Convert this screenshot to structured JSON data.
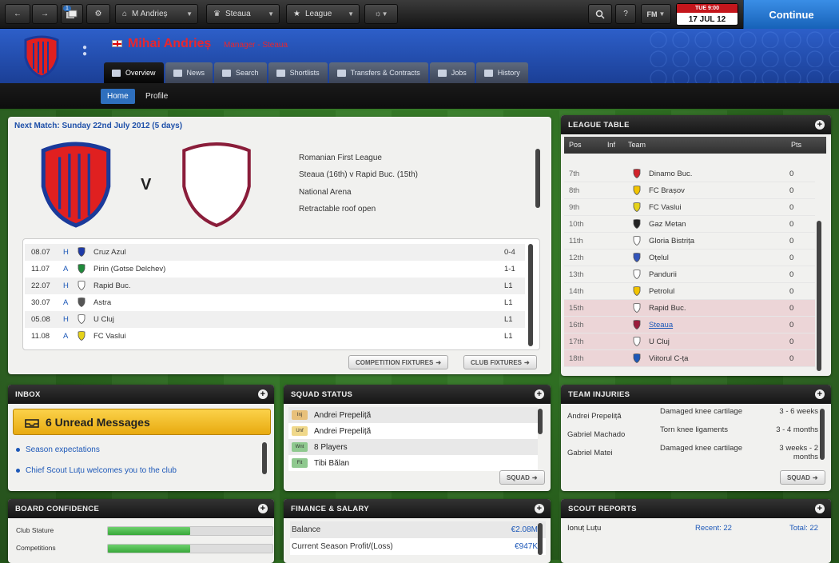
{
  "topbar": {
    "manager_dropdown": "M Andrieș",
    "club_dropdown": "Steaua",
    "league_dropdown": "League",
    "fm_menu": "FM",
    "badge_count": "1",
    "date_top": "TUE 9:00",
    "date_main": "17 JUL 12",
    "continue": "Continue"
  },
  "header": {
    "manager_name": "Mihai Andrieș",
    "manager_role": "Manager - Steaua",
    "tabs": [
      "Overview",
      "News",
      "Search",
      "Shortlists",
      "Transfers & Contracts",
      "Jobs",
      "History"
    ]
  },
  "subnav": [
    "Home",
    "Profile"
  ],
  "next_match": {
    "title": "Next Match: Sunday 22nd July 2012 (5 days)",
    "vs": "V",
    "info": [
      "Romanian First League",
      "Steaua (16th) v Rapid Buc. (15th)",
      "National Arena",
      "Retractable roof open"
    ],
    "fixtures": [
      {
        "date": "08.07",
        "venue": "H",
        "team": "Cruz Azul",
        "result": "0-4",
        "color": "#1e3aa8"
      },
      {
        "date": "11.07",
        "venue": "A",
        "team": "Pirin (Gotse Delchev)",
        "result": "1-1",
        "color": "#1f8a3a"
      },
      {
        "date": "22.07",
        "venue": "H",
        "team": "Rapid Buc.",
        "result": "L1",
        "color": "#ffffff"
      },
      {
        "date": "30.07",
        "venue": "A",
        "team": "Astra",
        "result": "L1",
        "color": "#555555"
      },
      {
        "date": "05.08",
        "venue": "H",
        "team": "U Cluj",
        "result": "L1",
        "color": "#ffffff"
      },
      {
        "date": "11.08",
        "venue": "A",
        "team": "FC Vaslui",
        "result": "L1",
        "color": "#e5d21a"
      }
    ],
    "btn_competition": "COMPETITION FIXTURES",
    "btn_club": "CLUB FIXTURES"
  },
  "league_table": {
    "title": "LEAGUE TABLE",
    "headers": [
      "Pos",
      "Inf",
      "Team",
      "Pts"
    ],
    "rows": [
      {
        "pos": "7th",
        "team": "Dinamo Buc.",
        "pts": "0",
        "color": "#d2232a",
        "highlight": false
      },
      {
        "pos": "8th",
        "team": "FC Brașov",
        "pts": "0",
        "color": "#f2c400",
        "highlight": false
      },
      {
        "pos": "9th",
        "team": "FC Vaslui",
        "pts": "0",
        "color": "#e5d21a",
        "highlight": false
      },
      {
        "pos": "10th",
        "team": "Gaz Metan",
        "pts": "0",
        "color": "#222222",
        "highlight": false
      },
      {
        "pos": "11th",
        "team": "Gloria Bistrița",
        "pts": "0",
        "color": "#ffffff",
        "highlight": false
      },
      {
        "pos": "12th",
        "team": "Oțelul",
        "pts": "0",
        "color": "#3355bb",
        "highlight": false
      },
      {
        "pos": "13th",
        "team": "Pandurii",
        "pts": "0",
        "color": "#ffffff",
        "highlight": false
      },
      {
        "pos": "14th",
        "team": "Petrolul",
        "pts": "0",
        "color": "#f2c400",
        "highlight": false
      },
      {
        "pos": "15th",
        "team": "Rapid Buc.",
        "pts": "0",
        "color": "#ffffff",
        "highlight": true
      },
      {
        "pos": "16th",
        "team": "Steaua",
        "pts": "0",
        "color": "#9b1b3b",
        "highlight": true,
        "link": true
      },
      {
        "pos": "17th",
        "team": "U Cluj",
        "pts": "0",
        "color": "#ffffff",
        "highlight": true
      },
      {
        "pos": "18th",
        "team": "Viitorul C-ța",
        "pts": "0",
        "color": "#1d58b8",
        "highlight": true
      }
    ]
  },
  "inbox": {
    "title": "INBOX",
    "unread": "6 Unread Messages",
    "messages": [
      "Season expectations",
      "Chief Scout Luțu welcomes you to the club"
    ]
  },
  "squad_status": {
    "title": "SQUAD STATUS",
    "rows": [
      {
        "badge": "Inj",
        "text": "Andrei Prepeliță",
        "color": "#e8c07a"
      },
      {
        "badge": "Unf",
        "text": "Andrei Prepeliță",
        "color": "#f0d88a"
      },
      {
        "badge": "Wnt",
        "text": "8 Players",
        "color": "#8fc98f"
      },
      {
        "badge": "Fit",
        "text": "Tibi Bălan",
        "color": "#8fc98f"
      }
    ],
    "button": "SQUAD"
  },
  "team_injuries": {
    "title": "TEAM INJURIES",
    "rows": [
      {
        "name": "Andrei Prepeliță",
        "injury": "Damaged knee cartilage",
        "time": "3 - 6 weeks"
      },
      {
        "name": "Gabriel Machado",
        "injury": "Torn knee ligaments",
        "time": "3 - 4 months"
      },
      {
        "name": "Gabriel Matei",
        "injury": "Damaged knee cartilage",
        "time": "3 weeks - 2 months"
      }
    ],
    "button": "SQUAD"
  },
  "board_confidence": {
    "title": "BOARD CONFIDENCE",
    "rows": [
      {
        "label": "Club Stature",
        "level": 0.5
      },
      {
        "label": "Competitions",
        "level": 0.5
      }
    ]
  },
  "finance": {
    "title": "FINANCE & SALARY",
    "rows": [
      {
        "label": "Balance",
        "value": "€2.08M"
      },
      {
        "label": "Current Season Profit/(Loss)",
        "value": "€947K"
      }
    ]
  },
  "scout_reports": {
    "title": "SCOUT REPORTS",
    "name": "Ionuț Luțu",
    "recent": "Recent: 22",
    "total": "Total: 22"
  },
  "colors": {
    "accent": "#1d58b8",
    "header_blue": "#2552b8",
    "club_red": "#e8262e",
    "highlight": "#ecd5d7"
  }
}
